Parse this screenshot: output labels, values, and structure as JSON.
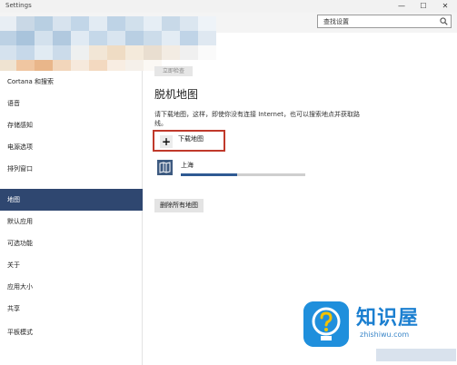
{
  "window": {
    "title": "Settings",
    "controls": {
      "minimize": "—",
      "maximize": "☐",
      "close": "✕"
    }
  },
  "search": {
    "placeholder": "查找设置"
  },
  "sidebar": {
    "items": [
      {
        "label": "Cortana 和搜索",
        "selected": false
      },
      {
        "label": "语音",
        "selected": false
      },
      {
        "label": "存储感知",
        "selected": false
      },
      {
        "label": "电源选项",
        "selected": false
      },
      {
        "label": "排列窗口",
        "selected": false
      },
      {
        "label": "地图",
        "selected": true
      },
      {
        "label": "默认应用",
        "selected": false
      },
      {
        "label": "可选功能",
        "selected": false
      },
      {
        "label": "关于",
        "selected": false
      },
      {
        "label": "应用大小",
        "selected": false
      },
      {
        "label": "共享",
        "selected": false
      },
      {
        "label": "平板模式",
        "selected": false
      }
    ]
  },
  "main": {
    "top_button": "立即检查",
    "title": "脱机地图",
    "description": "请下载地图，这样，即使你没有连接 Internet，也可以搜索地点并获取路线。",
    "add_button_label": "下载地图",
    "downloaded_maps": [
      {
        "name": "上海",
        "progress": 0.45
      }
    ],
    "delete_button": "删除所有地图"
  },
  "watermark": {
    "title": "知识屋",
    "domain": "zhishiwu.com"
  },
  "colors": {
    "selected_nav": "#2f4770",
    "accent": "#2f5a93",
    "highlight_box": "#c0392b",
    "watermark_blue": "#1f8fdc"
  }
}
